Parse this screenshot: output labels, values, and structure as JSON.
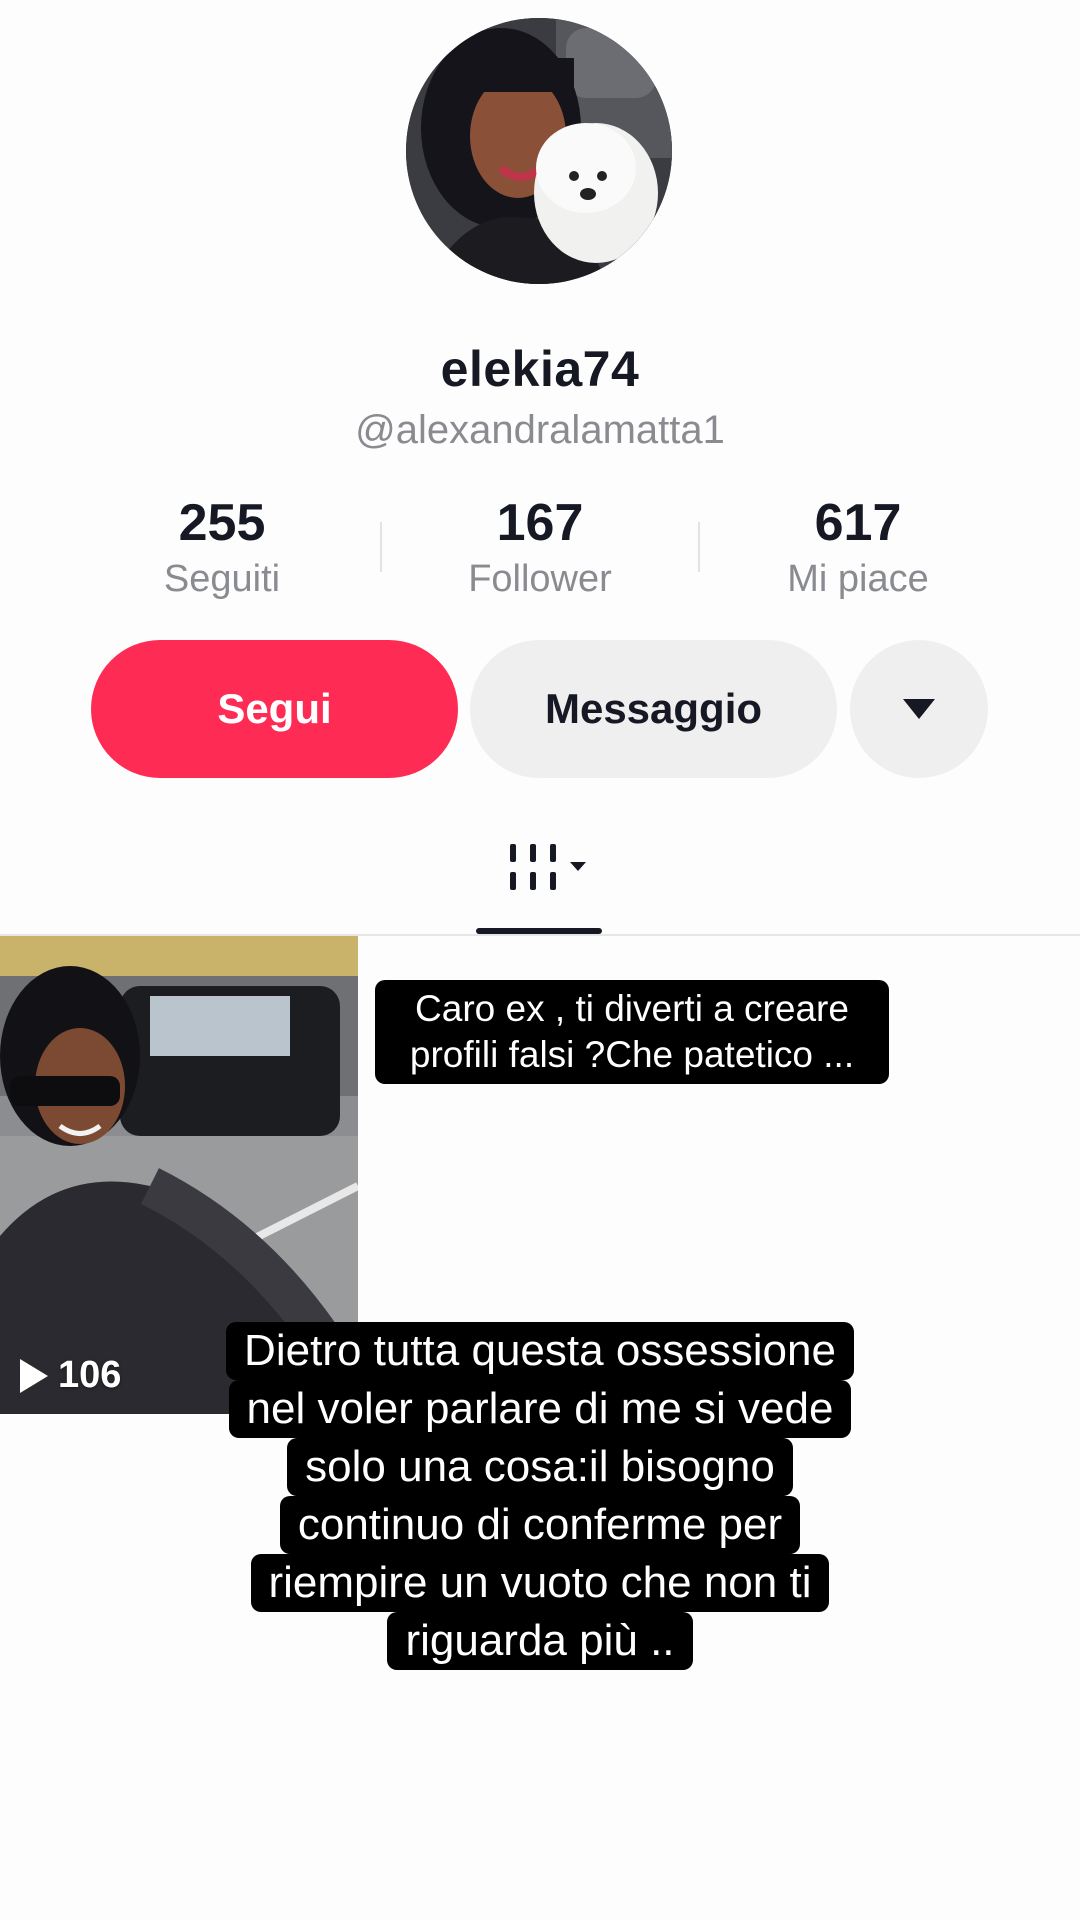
{
  "profile": {
    "display_name": "elekia74",
    "handle": "@alexandralamatta1"
  },
  "stats": [
    {
      "value": "255",
      "label": "Seguiti"
    },
    {
      "value": "167",
      "label": "Follower"
    },
    {
      "value": "617",
      "label": "Mi piace"
    }
  ],
  "actions": {
    "follow_label": "Segui",
    "message_label": "Messaggio",
    "more_icon": "caret-down-icon"
  },
  "tabs": {
    "active_icon": "videos-grid-icon"
  },
  "videos": [
    {
      "views": "106"
    }
  ],
  "captions": {
    "top": [
      "Caro ex , ti diverti a creare",
      "profili falsi ?Che patetico ..."
    ],
    "bottom": [
      "Dietro tutta questa ossessione",
      "nel voler parlare di me si vede",
      "solo una cosa:il bisogno",
      "continuo di conferme per",
      "riempire un vuoto che non ti",
      "riguarda più .."
    ]
  },
  "colors": {
    "accent": "#fe2c55",
    "text_primary": "#161823",
    "text_secondary": "#8a8b91",
    "button_secondary_bg": "#efeff0",
    "caption_bg": "#000000"
  }
}
